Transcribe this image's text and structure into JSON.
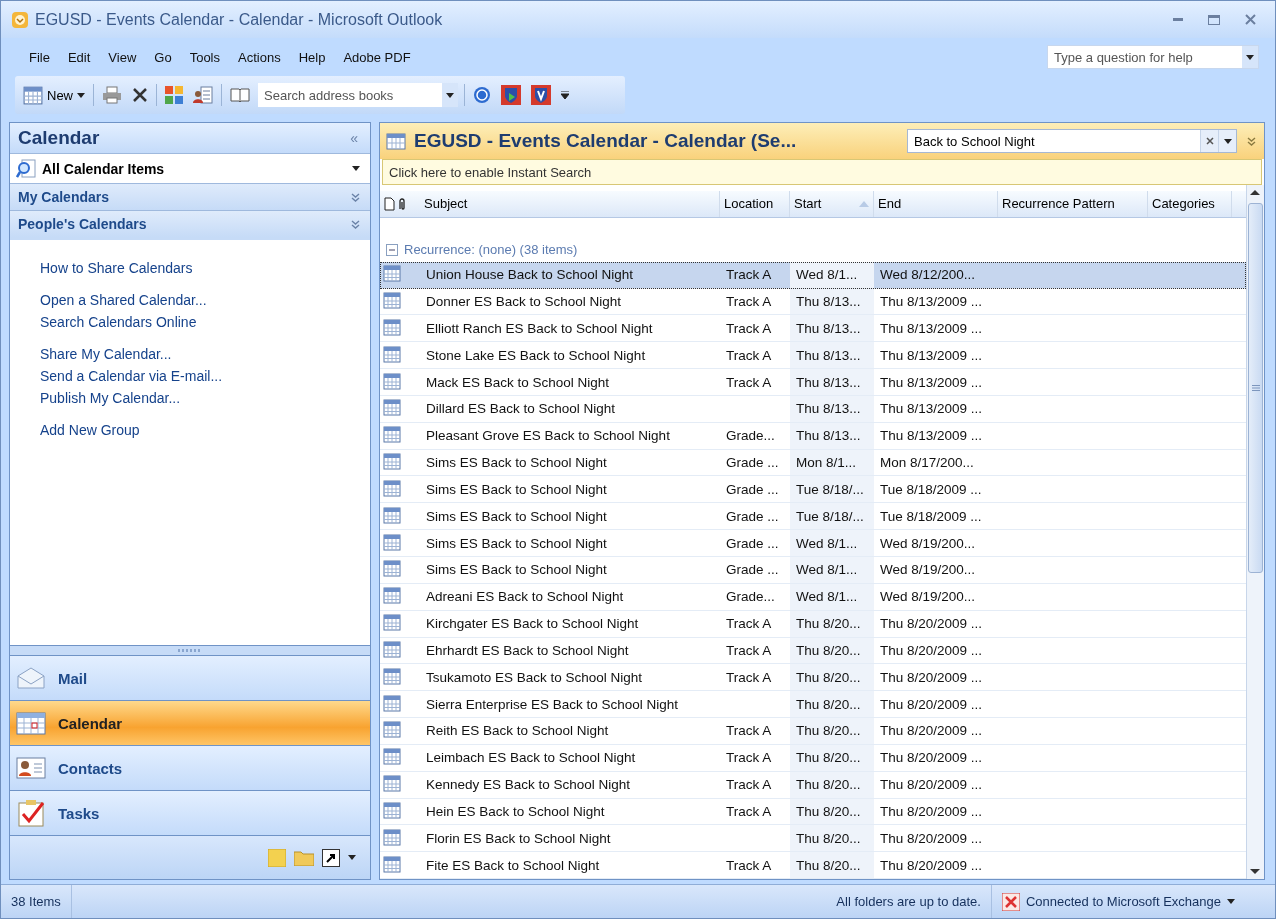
{
  "window": {
    "title": "EGUSD - Events Calendar - Calendar - Microsoft Outlook"
  },
  "menu": [
    "File",
    "Edit",
    "View",
    "Go",
    "Tools",
    "Actions",
    "Help",
    "Adobe PDF"
  ],
  "help_box": {
    "placeholder": "Type a question for help"
  },
  "toolbar": {
    "new_label": "New",
    "address_search": {
      "placeholder": "Search address books"
    }
  },
  "nav_pane": {
    "title": "Calendar",
    "collapse": "«",
    "view_picker": "All Calendar Items",
    "sections": [
      {
        "label": "My Calendars",
        "expanded": false
      },
      {
        "label": "People's Calendars",
        "expanded": false
      }
    ],
    "links": [
      [
        "How to Share Calendars"
      ],
      [
        "Open a Shared Calendar...",
        "Search Calendars Online"
      ],
      [
        "Share My Calendar...",
        "Send a Calendar via E-mail...",
        "Publish My Calendar..."
      ],
      [
        "Add New Group"
      ]
    ],
    "buttons": [
      {
        "label": "Mail",
        "kind": "mail",
        "selected": false
      },
      {
        "label": "Calendar",
        "kind": "calendar",
        "selected": true
      },
      {
        "label": "Contacts",
        "kind": "contacts",
        "selected": false
      },
      {
        "label": "Tasks",
        "kind": "tasks",
        "selected": false
      }
    ]
  },
  "content": {
    "title": "EGUSD - Events Calendar - Calendar (Se...",
    "search": {
      "value": "Back to School Night"
    },
    "instant_search_banner": "Click here to enable Instant Search",
    "columns": [
      "Subject",
      "Location",
      "Start",
      "End",
      "Recurrence Pattern",
      "Categories"
    ],
    "group": "Recurrence: (none) (38 items)",
    "group_expanded": true,
    "rows": [
      {
        "subject": "Union House Back to School Night",
        "location": "Track A",
        "start": "Wed 8/1...",
        "end": "Wed 8/12/200...",
        "selected": true
      },
      {
        "subject": "Donner ES Back to School Night",
        "location": "Track A",
        "start": "Thu 8/13...",
        "end": "Thu 8/13/2009 ...",
        "selected": false
      },
      {
        "subject": "Elliott Ranch ES Back to School Night",
        "location": "Track A",
        "start": "Thu 8/13...",
        "end": "Thu 8/13/2009 ...",
        "selected": false
      },
      {
        "subject": "Stone Lake ES Back to School Night",
        "location": "Track A",
        "start": "Thu 8/13...",
        "end": "Thu 8/13/2009 ...",
        "selected": false
      },
      {
        "subject": "Mack ES Back to School Night",
        "location": "Track A",
        "start": "Thu 8/13...",
        "end": "Thu 8/13/2009 ...",
        "selected": false
      },
      {
        "subject": "Dillard ES Back to School Night",
        "location": "",
        "start": "Thu 8/13...",
        "end": "Thu 8/13/2009 ...",
        "selected": false
      },
      {
        "subject": "Pleasant Grove ES Back to School Night",
        "location": "Grade...",
        "start": "Thu 8/13...",
        "end": "Thu 8/13/2009 ...",
        "selected": false
      },
      {
        "subject": "Sims ES Back to School Night",
        "location": "Grade ...",
        "start": "Mon 8/1...",
        "end": "Mon 8/17/200...",
        "selected": false
      },
      {
        "subject": "Sims ES Back to School Night",
        "location": "Grade ...",
        "start": "Tue 8/18/...",
        "end": "Tue 8/18/2009 ...",
        "selected": false
      },
      {
        "subject": "Sims ES Back to School Night",
        "location": "Grade ...",
        "start": "Tue 8/18/...",
        "end": "Tue 8/18/2009 ...",
        "selected": false
      },
      {
        "subject": "Sims ES Back to School Night",
        "location": "Grade ...",
        "start": "Wed 8/1...",
        "end": "Wed 8/19/200...",
        "selected": false
      },
      {
        "subject": "Sims ES Back to School Night",
        "location": "Grade ...",
        "start": "Wed 8/1...",
        "end": "Wed 8/19/200...",
        "selected": false
      },
      {
        "subject": "Adreani ES Back to School Night",
        "location": "Grade...",
        "start": "Wed 8/1...",
        "end": "Wed 8/19/200...",
        "selected": false
      },
      {
        "subject": "Kirchgater ES Back to School Night",
        "location": "Track A",
        "start": "Thu 8/20...",
        "end": "Thu 8/20/2009 ...",
        "selected": false
      },
      {
        "subject": "Ehrhardt ES Back to School Night",
        "location": "Track A",
        "start": "Thu 8/20...",
        "end": "Thu 8/20/2009 ...",
        "selected": false
      },
      {
        "subject": "Tsukamoto ES Back to School Night",
        "location": "Track A",
        "start": "Thu 8/20...",
        "end": "Thu 8/20/2009 ...",
        "selected": false
      },
      {
        "subject": "Sierra Enterprise ES Back to School Night",
        "location": "",
        "start": "Thu 8/20...",
        "end": "Thu 8/20/2009 ...",
        "selected": false
      },
      {
        "subject": "Reith ES Back to School Night",
        "location": "Track A",
        "start": "Thu 8/20...",
        "end": "Thu 8/20/2009 ...",
        "selected": false
      },
      {
        "subject": "Leimbach ES Back to School Night",
        "location": "Track A",
        "start": "Thu 8/20...",
        "end": "Thu 8/20/2009 ...",
        "selected": false
      },
      {
        "subject": "Kennedy ES Back to School Night",
        "location": "Track A",
        "start": "Thu 8/20...",
        "end": "Thu 8/20/2009 ...",
        "selected": false
      },
      {
        "subject": "Hein ES Back to School Night",
        "location": "Track A",
        "start": "Thu 8/20...",
        "end": "Thu 8/20/2009 ...",
        "selected": false
      },
      {
        "subject": "Florin ES Back to School Night",
        "location": "",
        "start": "Thu 8/20...",
        "end": "Thu 8/20/2009 ...",
        "selected": false
      },
      {
        "subject": "Fite ES Back to School Night",
        "location": "Track A",
        "start": "Thu 8/20...",
        "end": "Thu 8/20/2009 ...",
        "selected": false
      }
    ]
  },
  "status_bar": {
    "count": "38 Items",
    "sync": "All folders are up to date.",
    "connection": "Connected to Microsoft Exchange"
  }
}
